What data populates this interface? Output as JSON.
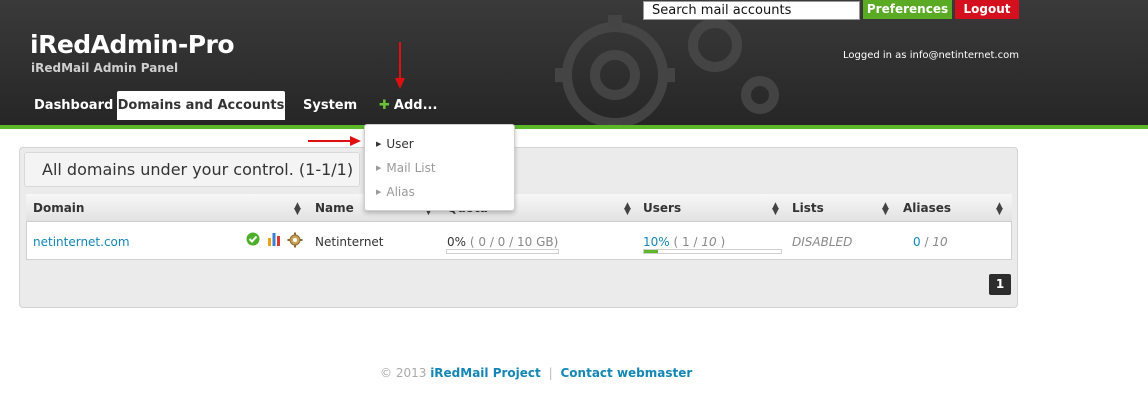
{
  "app": {
    "title": "iRedAdmin-Pro",
    "tagline": "iRedMail Admin Panel"
  },
  "topbar": {
    "search_value": "Search mail accounts",
    "preferences_label": "Preferences",
    "logout_label": "Logout",
    "logged_in_text": "Logged in as info@netinternet.com"
  },
  "nav": {
    "items": [
      {
        "label": "Dashboard"
      },
      {
        "label": "Domains and Accounts",
        "active": true
      },
      {
        "label": "System"
      },
      {
        "label": "Add..."
      }
    ]
  },
  "add_menu": {
    "items": [
      {
        "label": "User",
        "enabled": true
      },
      {
        "label": "Mail List",
        "enabled": false
      },
      {
        "label": "Alias",
        "enabled": false
      }
    ]
  },
  "panel": {
    "title": "All domains under your control. (1-1/1)"
  },
  "table": {
    "headers": [
      "Domain",
      "Name",
      "Quota",
      "Users",
      "Lists",
      "Aliases"
    ],
    "rows": [
      {
        "domain": "netinternet.com",
        "name": "Netinternet",
        "quota_percent": "0%",
        "quota_detail": "( 0 / 0 / 10 GB)",
        "quota_fill": 0,
        "users_percent": "10%",
        "users_open": "( 1 /",
        "users_max": "10",
        "users_close": ")",
        "users_fill": 0.1,
        "lists": "DISABLED",
        "aliases_count": "0",
        "aliases_sep": "/",
        "aliases_max": "10"
      }
    ]
  },
  "pagination": {
    "current_page": "1"
  },
  "footer": {
    "copyright": "© 2013",
    "project_link": "iRedMail Project",
    "separator": "|",
    "contact_link": "Contact webmaster"
  },
  "colors": {
    "accent_green": "#5cb82a",
    "logout_red": "#d4101e",
    "link_blue": "#1386b6",
    "header_dark": "#2e2e2e"
  },
  "icons": [
    "plus-icon",
    "active-check-icon",
    "statistics-chart-icon",
    "settings-gear-icon",
    "sort-arrows-icon",
    "caret-right-icon",
    "annotation-arrow-icon"
  ]
}
